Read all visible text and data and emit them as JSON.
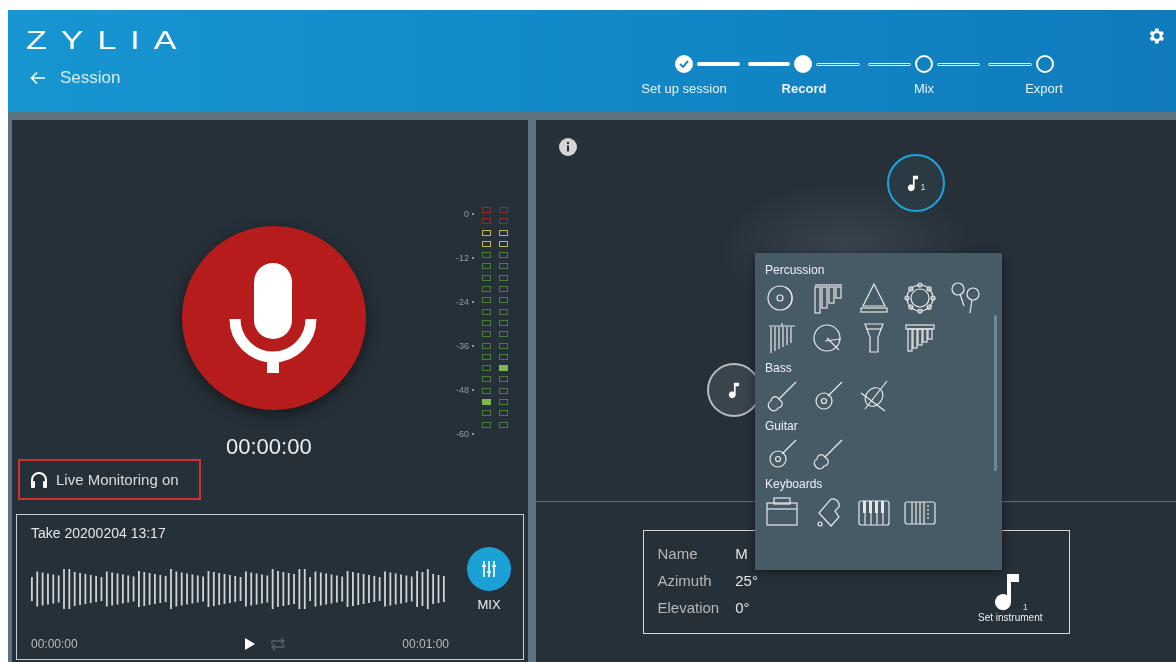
{
  "header": {
    "logo": "ZYLIA",
    "back_label": "Session"
  },
  "steps": [
    {
      "label": "Set up session",
      "kind": "done",
      "selected": false
    },
    {
      "label": "Record",
      "kind": "current",
      "selected": true
    },
    {
      "label": "Mix",
      "kind": "pending",
      "selected": false
    },
    {
      "label": "Export",
      "kind": "pending",
      "selected": false
    }
  ],
  "recorder": {
    "timer": "00:00:00",
    "live_monitoring": "Live Monitoring on"
  },
  "meter": {
    "scale": [
      "0",
      "-12",
      "-24",
      "-36",
      "-48",
      "-60"
    ],
    "channels": [
      {
        "level": 0.15
      },
      {
        "level": 0.3
      }
    ]
  },
  "take": {
    "title": "Take 20200204 13:17",
    "mix_label": "MIX",
    "start_time": "00:00:00",
    "end_time": "00:01:00",
    "loop_enabled": false
  },
  "sources": [
    {
      "number": "1",
      "selected": true
    },
    {
      "selected": false
    }
  ],
  "instrument_menu": {
    "categories": [
      {
        "title": "Percussion",
        "instruments": [
          {
            "kind": "cymbal"
          },
          {
            "kind": "xylophone"
          },
          {
            "kind": "triangle"
          },
          {
            "kind": "tambourine"
          },
          {
            "kind": "maracas"
          },
          {
            "kind": "chimes"
          },
          {
            "kind": "drum"
          },
          {
            "kind": "djembe"
          },
          {
            "kind": "marimba"
          }
        ]
      },
      {
        "title": "Bass",
        "instruments": [
          {
            "kind": "electric-guitar"
          },
          {
            "kind": "acoustic-guitar"
          },
          {
            "kind": "cello"
          }
        ]
      },
      {
        "title": "Guitar",
        "instruments": [
          {
            "kind": "acoustic-guitar"
          },
          {
            "kind": "electric-guitar"
          }
        ]
      },
      {
        "title": "Keyboards",
        "instruments": [
          {
            "kind": "organ"
          },
          {
            "kind": "grand-piano"
          },
          {
            "kind": "piano-keys"
          },
          {
            "kind": "accordion"
          }
        ]
      }
    ]
  },
  "source_info": {
    "fields": [
      {
        "label": "Name",
        "value": "M"
      },
      {
        "label": "Azimuth",
        "value": "25°"
      },
      {
        "label": "Elevation",
        "value": "0°"
      }
    ],
    "instrument_label": "Set instrument",
    "number": "1"
  }
}
